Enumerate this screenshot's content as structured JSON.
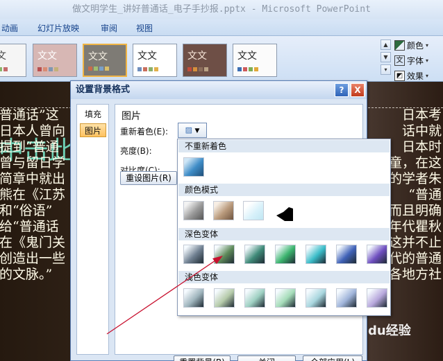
{
  "window": {
    "title": "做文明学生_讲好普通话_电子手抄报.pptx - Microsoft PowerPoint"
  },
  "ribbon_tabs": [
    "动画",
    "幻灯片放映",
    "审阅",
    "视图"
  ],
  "themes": [
    {
      "label": "文文",
      "bg": "#f5f5f5",
      "fg": "#444444",
      "dots": [
        "#7aa7d2",
        "#d8a45b",
        "#8bb56a",
        "#c36c6c"
      ]
    },
    {
      "label": "文文",
      "bg": "#d7b7b4",
      "fg": "#ffffff",
      "dots": [
        "#b84f4f",
        "#d98c73",
        "#7f97b2",
        "#c4b07a"
      ]
    },
    {
      "label": "文文",
      "bg": "#7e7b75",
      "fg": "#f4efe2",
      "dots": [
        "#c86b4a",
        "#9fbd6e",
        "#7aa0c8",
        "#d8be6a"
      ]
    },
    {
      "label": "文文",
      "bg": "#ffffff",
      "fg": "#222222",
      "dots": [
        "#6f8ebd",
        "#c96f5c",
        "#8bb06a",
        "#e1b04c"
      ]
    },
    {
      "label": "文文",
      "bg": "#6e4f46",
      "fg": "#f8e7da",
      "dots": [
        "#c24b3a",
        "#d68f3b",
        "#8a6c5a",
        "#b9a184"
      ]
    },
    {
      "label": "文文",
      "bg": "#fbfbfb",
      "fg": "#222222",
      "dots": [
        "#3d6fb3",
        "#cd5a5a",
        "#7fae55",
        "#e0a83a"
      ]
    }
  ],
  "side_panel": {
    "colors": "颜色",
    "fonts": "字体",
    "effects": "效果"
  },
  "slide": {
    "title": "中击此",
    "left_lines": [
      "普通话”这",
      "日本人曾向",
      "提到“普通",
      "曾与留日学",
      "简章中就出",
      "熊在《江苏",
      "和“俗语”",
      "给“普通话",
      "在《鬼门关",
      "创造出一些",
      "的文脉。”"
    ],
    "right_lines": [
      "日本考",
      "话中就",
      "日本时",
      "童，在这",
      "的学者朱",
      "“普通",
      "而且明确",
      "年代瞿秋",
      "”这并不止",
      "现代的普通",
      "国各地方社"
    ],
    "watermark": "Baidu经验"
  },
  "dialog": {
    "title": "设置背景格式",
    "help_label": "?",
    "close_label": "X",
    "nav": [
      {
        "label": "填充",
        "active": false
      },
      {
        "label": "图片",
        "active": true
      }
    ],
    "section_title": "图片",
    "recolor_label": "重新着色(E):",
    "brightness_label": "亮度(B):",
    "contrast_label": "对比度(C):",
    "reset_button": "重设图片(R)",
    "bottom_buttons": [
      "重置背景(B)",
      "关闭",
      "全部应用(L)"
    ]
  },
  "recolor_menu": {
    "no_recolor": "不重新着色",
    "color_modes": "颜色模式",
    "dark_variations": "深色变体",
    "light_variations": "浅色变体",
    "dark_colors": [
      "#6f7f90",
      "#5e8a5a",
      "#3f8a78",
      "#3bb46e",
      "#3abcc8",
      "#4062b8",
      "#6f4fc0"
    ],
    "light_colors": [
      "#9fb5bd",
      "#b5caa9",
      "#9ed0c2",
      "#a5dcb9",
      "#a8d6de",
      "#9fb4da",
      "#b7a7dc"
    ]
  }
}
